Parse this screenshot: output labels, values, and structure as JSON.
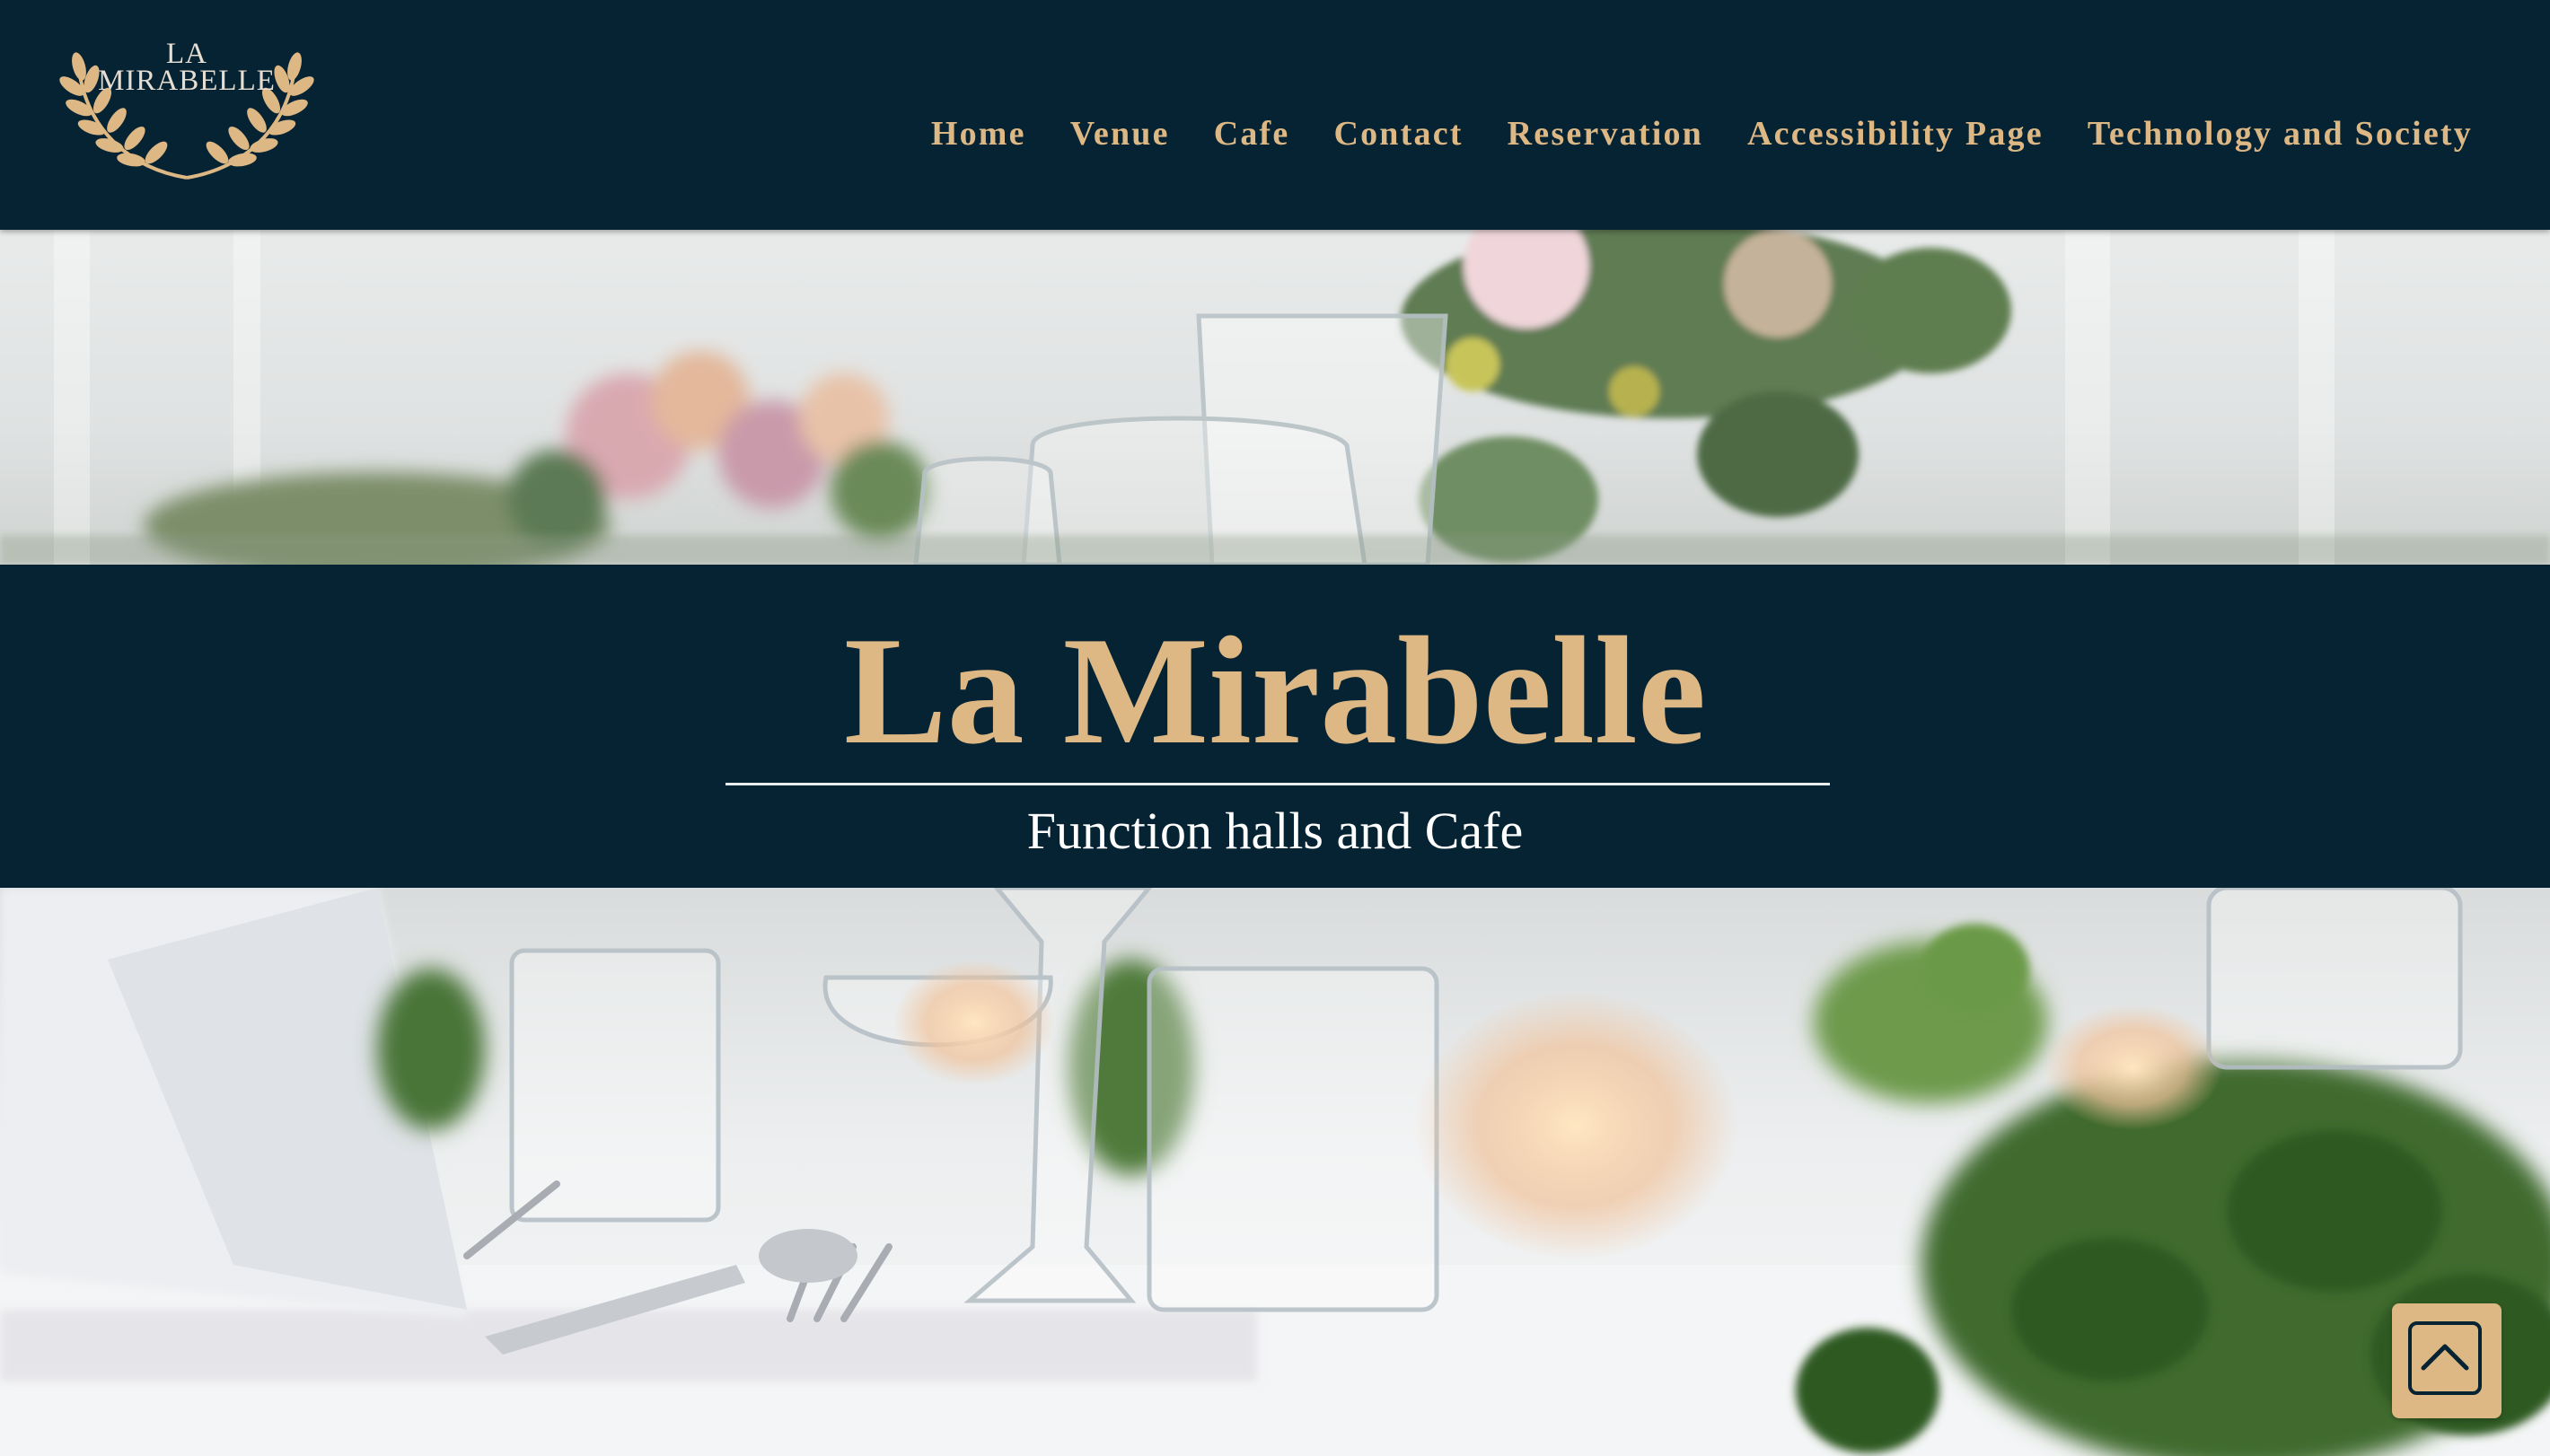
{
  "header": {
    "logo": {
      "line1": "LA",
      "line2": "MIRABELLE"
    },
    "nav": [
      {
        "label": "Home"
      },
      {
        "label": "Venue"
      },
      {
        "label": "Cafe"
      },
      {
        "label": "Contact"
      },
      {
        "label": "Reservation"
      },
      {
        "label": "Accessibility Page"
      },
      {
        "label": "Technology and Society"
      }
    ]
  },
  "hero": {
    "title": "La Mirabelle",
    "subtitle": "Function halls and Cafe"
  },
  "icons": {
    "logo_wreath": "laurel-wreath-icon",
    "back_to_top": "chevron-up-icon"
  },
  "colors": {
    "navy": "#052333",
    "gold": "#ddb784",
    "white": "#ffffff"
  }
}
